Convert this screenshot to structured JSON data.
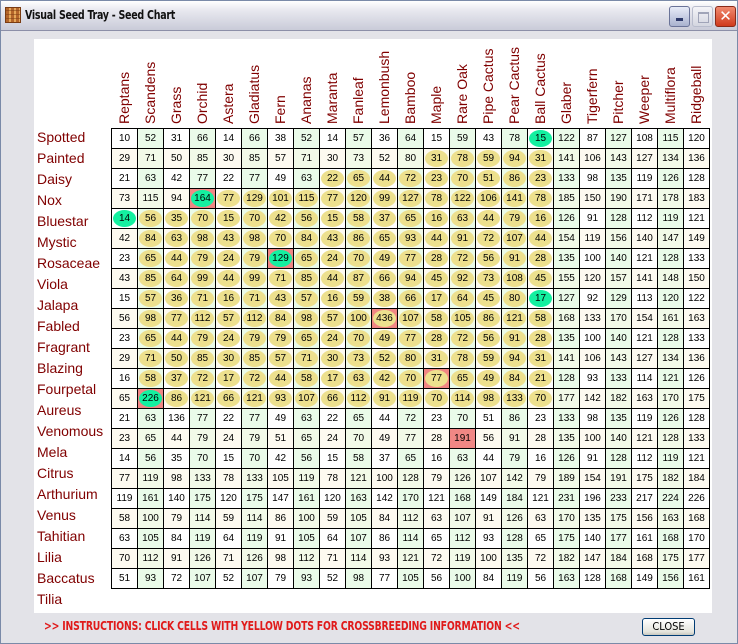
{
  "window": {
    "title": "Visual Seed Tray - Seed Chart",
    "icon": "seed-tray-icon",
    "controls": {
      "minimize": "minimize-icon",
      "maximize": "maximize-icon",
      "close": "close-icon",
      "close_glyph": "✕"
    }
  },
  "colors": {
    "label_text": "#800000",
    "yellow_dot": "#ede08e",
    "green_dot": "#14f0a0",
    "red_cell": "#f08784",
    "instruction_text": "#e01a1a"
  },
  "columns": [
    "Reptans",
    "Scandens",
    "Grass",
    "Orchid",
    "Astera",
    "Gladiatus",
    "Fern",
    "Ananas",
    "Maranta",
    "Fanleaf",
    "Lemonbush",
    "Bamboo",
    "Maple",
    "Rare Oak",
    "Pipe Cactus",
    "Pear Cactus",
    "Ball Cactus",
    "Glaber",
    "Tigerfern",
    "Pitcher",
    "Weeper",
    "Multiflora",
    "Ridgeball"
  ],
  "rows": [
    {
      "label": "Spotted",
      "values": [
        10,
        52,
        31,
        66,
        14,
        66,
        38,
        52,
        14,
        57,
        36,
        64,
        15,
        59,
        43,
        78,
        15,
        122,
        87,
        127,
        108,
        115,
        120
      ],
      "yellow": [],
      "green": [
        16
      ],
      "red": []
    },
    {
      "label": "Painted",
      "values": [
        29,
        71,
        50,
        85,
        30,
        85,
        57,
        71,
        30,
        73,
        52,
        80,
        31,
        78,
        59,
        94,
        31,
        141,
        106,
        143,
        127,
        134,
        136
      ],
      "yellow": [
        12,
        13,
        14,
        15,
        16
      ],
      "green": [],
      "red": []
    },
    {
      "label": "Daisy",
      "values": [
        21,
        63,
        42,
        77,
        22,
        77,
        49,
        63,
        22,
        65,
        44,
        72,
        23,
        70,
        51,
        86,
        23,
        133,
        98,
        135,
        119,
        126,
        128
      ],
      "yellow": [
        8,
        9,
        10,
        11,
        12,
        13,
        14,
        15,
        16
      ],
      "green": [],
      "red": []
    },
    {
      "label": "Nox",
      "values": [
        73,
        115,
        94,
        164,
        77,
        129,
        101,
        115,
        77,
        120,
        99,
        127,
        78,
        122,
        106,
        141,
        78,
        185,
        150,
        190,
        171,
        178,
        183
      ],
      "yellow": [
        4,
        5,
        6,
        7,
        8,
        9,
        10,
        11,
        12,
        13,
        14,
        15,
        16
      ],
      "green": [
        3
      ],
      "red": [
        3
      ]
    },
    {
      "label": "Bluestar",
      "values": [
        14,
        56,
        35,
        70,
        15,
        70,
        42,
        56,
        15,
        58,
        37,
        65,
        16,
        63,
        44,
        79,
        16,
        126,
        91,
        128,
        112,
        119,
        121
      ],
      "yellow": [
        1,
        2,
        3,
        4,
        5,
        6,
        7,
        8,
        9,
        10,
        11,
        12,
        13,
        14,
        15,
        16
      ],
      "green": [
        0
      ],
      "red": []
    },
    {
      "label": "Mystic",
      "values": [
        42,
        84,
        63,
        98,
        43,
        98,
        70,
        84,
        43,
        86,
        65,
        93,
        44,
        91,
        72,
        107,
        44,
        154,
        119,
        156,
        140,
        147,
        149
      ],
      "yellow": [
        1,
        2,
        3,
        4,
        5,
        6,
        7,
        8,
        9,
        10,
        11,
        12,
        13,
        14,
        15,
        16
      ],
      "green": [],
      "red": []
    },
    {
      "label": "Rosaceae",
      "values": [
        23,
        65,
        44,
        79,
        24,
        79,
        129,
        65,
        24,
        70,
        49,
        77,
        28,
        72,
        56,
        91,
        28,
        135,
        100,
        140,
        121,
        128,
        133
      ],
      "yellow": [
        1,
        2,
        3,
        4,
        5,
        7,
        8,
        9,
        10,
        11,
        12,
        13,
        14,
        15,
        16
      ],
      "green": [
        6
      ],
      "red": [
        6
      ]
    },
    {
      "label": "Viola",
      "values": [
        43,
        85,
        64,
        99,
        44,
        99,
        71,
        85,
        44,
        87,
        66,
        94,
        45,
        92,
        73,
        108,
        45,
        155,
        120,
        157,
        141,
        148,
        150
      ],
      "yellow": [
        1,
        2,
        3,
        4,
        5,
        6,
        7,
        8,
        9,
        10,
        11,
        12,
        13,
        14,
        15,
        16
      ],
      "green": [],
      "red": []
    },
    {
      "label": "Jalapa",
      "values": [
        15,
        57,
        36,
        71,
        16,
        71,
        43,
        57,
        16,
        59,
        38,
        66,
        17,
        64,
        45,
        80,
        17,
        127,
        92,
        129,
        113,
        120,
        122
      ],
      "yellow": [
        1,
        2,
        3,
        4,
        5,
        6,
        7,
        8,
        9,
        10,
        11,
        12,
        13,
        14,
        15
      ],
      "green": [
        16
      ],
      "red": []
    },
    {
      "label": "Fabled",
      "values": [
        56,
        98,
        77,
        112,
        57,
        112,
        84,
        98,
        57,
        100,
        436,
        107,
        58,
        105,
        86,
        121,
        58,
        168,
        133,
        170,
        154,
        161,
        163
      ],
      "yellow": [
        1,
        2,
        3,
        4,
        5,
        6,
        7,
        8,
        9,
        10,
        11,
        12,
        13,
        14,
        15,
        16
      ],
      "green": [],
      "red": [
        10
      ]
    },
    {
      "label": "Fragrant",
      "values": [
        23,
        65,
        44,
        79,
        24,
        79,
        79,
        65,
        24,
        70,
        49,
        77,
        28,
        72,
        56,
        91,
        28,
        135,
        100,
        140,
        121,
        128,
        133
      ],
      "yellow": [
        1,
        2,
        3,
        4,
        5,
        6,
        7,
        8,
        9,
        10,
        11,
        12,
        13,
        14,
        15,
        16
      ],
      "green": [],
      "red": []
    },
    {
      "label": "Blazing",
      "values": [
        29,
        71,
        50,
        85,
        30,
        85,
        57,
        71,
        30,
        73,
        52,
        80,
        31,
        78,
        59,
        94,
        31,
        141,
        106,
        143,
        127,
        134,
        136
      ],
      "yellow": [
        1,
        2,
        3,
        4,
        5,
        6,
        7,
        8,
        9,
        10,
        11,
        12,
        13,
        14,
        15,
        16
      ],
      "green": [],
      "red": []
    },
    {
      "label": "Fourpetal",
      "values": [
        16,
        58,
        37,
        72,
        17,
        72,
        44,
        58,
        17,
        63,
        42,
        70,
        77,
        65,
        49,
        84,
        21,
        128,
        93,
        133,
        114,
        121,
        126
      ],
      "yellow": [
        1,
        2,
        3,
        4,
        5,
        6,
        7,
        8,
        9,
        10,
        11,
        12,
        13,
        14,
        15,
        16
      ],
      "green": [],
      "red": [
        12
      ]
    },
    {
      "label": "Aureus",
      "values": [
        65,
        226,
        86,
        121,
        66,
        121,
        93,
        107,
        66,
        112,
        91,
        119,
        70,
        114,
        98,
        133,
        70,
        177,
        142,
        182,
        163,
        170,
        175
      ],
      "yellow": [
        2,
        3,
        4,
        5,
        6,
        7,
        8,
        9,
        10,
        11,
        12,
        13,
        14,
        15,
        16
      ],
      "green": [
        1
      ],
      "red": [
        1
      ]
    },
    {
      "label": "Venomous",
      "values": [
        21,
        63,
        136,
        77,
        22,
        77,
        49,
        63,
        22,
        65,
        44,
        72,
        23,
        70,
        51,
        86,
        23,
        133,
        98,
        135,
        119,
        126,
        128
      ],
      "yellow": [],
      "green": [],
      "red": []
    },
    {
      "label": "Mela",
      "values": [
        23,
        65,
        44,
        79,
        24,
        79,
        51,
        65,
        24,
        70,
        49,
        77,
        28,
        191,
        56,
        91,
        28,
        135,
        100,
        140,
        121,
        128,
        133
      ],
      "yellow": [],
      "green": [],
      "red": [
        13
      ]
    },
    {
      "label": "Citrus",
      "values": [
        14,
        56,
        35,
        70,
        15,
        70,
        42,
        56,
        15,
        58,
        37,
        65,
        16,
        63,
        44,
        79,
        16,
        126,
        91,
        128,
        112,
        119,
        121
      ],
      "yellow": [],
      "green": [],
      "red": []
    },
    {
      "label": "Arthurium",
      "values": [
        77,
        119,
        98,
        133,
        78,
        133,
        105,
        119,
        78,
        121,
        100,
        128,
        79,
        126,
        107,
        142,
        79,
        189,
        154,
        191,
        175,
        182,
        184
      ],
      "yellow": [],
      "green": [],
      "red": []
    },
    {
      "label": "Venus",
      "values": [
        119,
        161,
        140,
        175,
        120,
        175,
        147,
        161,
        120,
        163,
        142,
        170,
        121,
        168,
        149,
        184,
        121,
        231,
        196,
        233,
        217,
        224,
        226
      ],
      "yellow": [],
      "green": [],
      "red": []
    },
    {
      "label": "Tahitian",
      "values": [
        58,
        100,
        79,
        114,
        59,
        114,
        86,
        100,
        59,
        105,
        84,
        112,
        63,
        107,
        91,
        126,
        63,
        170,
        135,
        175,
        156,
        163,
        168
      ],
      "yellow": [],
      "green": [],
      "red": []
    },
    {
      "label": "Lilia",
      "values": [
        63,
        105,
        84,
        119,
        64,
        119,
        91,
        105,
        64,
        107,
        86,
        114,
        65,
        112,
        93,
        128,
        65,
        175,
        140,
        177,
        161,
        168,
        170
      ],
      "yellow": [],
      "green": [],
      "red": []
    },
    {
      "label": "Baccatus",
      "values": [
        70,
        112,
        91,
        126,
        71,
        126,
        98,
        112,
        71,
        114,
        93,
        121,
        72,
        119,
        100,
        135,
        72,
        182,
        147,
        184,
        168,
        175,
        177
      ],
      "yellow": [],
      "green": [],
      "red": []
    },
    {
      "label": "Tilia",
      "values": [
        51,
        93,
        72,
        107,
        52,
        107,
        79,
        93,
        52,
        98,
        77,
        105,
        56,
        100,
        84,
        119,
        56,
        163,
        128,
        168,
        149,
        156,
        161
      ],
      "yellow": [],
      "green": [],
      "red": []
    }
  ],
  "footer": {
    "instructions": ">> INSTRUCTIONS: CLICK CELLS WITH YELLOW DOTS FOR CROSSBREEDING INFORMATION <<",
    "close_label": "CLOSE"
  }
}
